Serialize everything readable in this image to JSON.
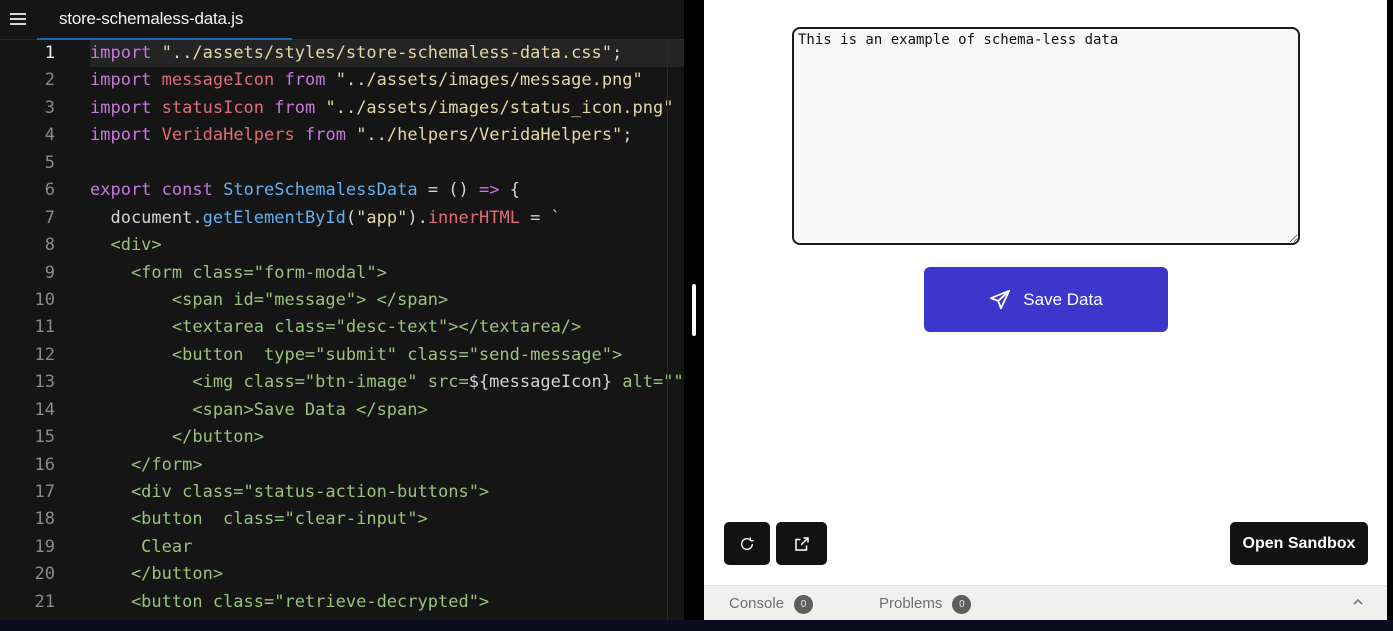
{
  "editor": {
    "file_tab": "store-schemaless-data.js",
    "line_numbers": [
      "1",
      "2",
      "3",
      "4",
      "5",
      "6",
      "7",
      "8",
      "9",
      "10",
      "11",
      "12",
      "13",
      "14",
      "15",
      "16",
      "17",
      "18",
      "19",
      "20",
      "21"
    ]
  },
  "preview": {
    "textarea_value": "This is an example of schema-less data",
    "save_button_label": "Save Data",
    "open_sandbox_label": "Open Sandbox"
  },
  "bottom_bar": {
    "console_label": "Console",
    "console_count": "0",
    "problems_label": "Problems",
    "problems_count": "0"
  },
  "colors": {
    "accent_button": "#3c36cd",
    "editor_bg": "#151515"
  }
}
